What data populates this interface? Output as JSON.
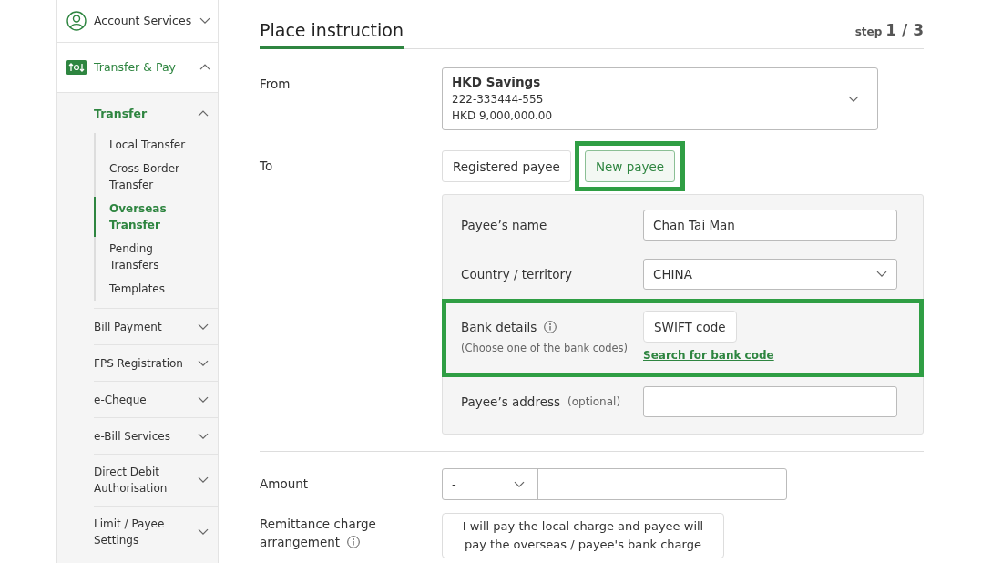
{
  "sidebar": {
    "sections": [
      {
        "label": "Account Services",
        "kind": "account",
        "expanded": false
      },
      {
        "label": "Transfer & Pay",
        "kind": "transfer",
        "expanded": true,
        "groups": [
          {
            "label": "Transfer",
            "expanded": true,
            "children": [
              {
                "label": "Local Transfer",
                "selected": false
              },
              {
                "label": "Cross-Border Transfer",
                "selected": false
              },
              {
                "label": "Overseas Transfer",
                "selected": true
              },
              {
                "label": "Pending Transfers",
                "selected": false
              },
              {
                "label": "Templates",
                "selected": false
              }
            ]
          },
          {
            "label": "Bill Payment",
            "expanded": false
          },
          {
            "label": "FPS Registration",
            "expanded": false
          },
          {
            "label": "e-Cheque",
            "expanded": false
          },
          {
            "label": "e-Bill Services",
            "expanded": false
          },
          {
            "label": "Direct Debit Authorisation",
            "expanded": false
          },
          {
            "label": "Limit / Payee Settings",
            "expanded": false
          }
        ]
      }
    ]
  },
  "header": {
    "title": "Place instruction",
    "step_label": "step",
    "step_value": "1 / 3"
  },
  "from": {
    "label": "From",
    "account": {
      "name": "HKD Savings",
      "number": "222-333444-555",
      "balance": "HKD 9,000,000.00"
    }
  },
  "to": {
    "label": "To",
    "options": [
      {
        "label": "Registered payee",
        "selected": false,
        "highlighted": false
      },
      {
        "label": "New payee",
        "selected": true,
        "highlighted": true
      }
    ]
  },
  "payee": {
    "rows": [
      {
        "kind": "text",
        "label": "Payee’s name",
        "value": "Chan Tai Man",
        "highlighted": false
      },
      {
        "kind": "select",
        "label": "Country / territory",
        "value": "CHINA",
        "highlighted": false
      },
      {
        "kind": "bank",
        "label": "Bank details",
        "hint": "(Choose one of the bank codes)",
        "button": "SWIFT code",
        "link": "Search for bank code",
        "highlighted": true
      },
      {
        "kind": "text",
        "label": "Payee’s address",
        "optional": "(optional)",
        "highlighted": false
      }
    ]
  },
  "amount": {
    "label": "Amount",
    "currency": "-"
  },
  "charge": {
    "label_lines": [
      "Remittance charge",
      "arrangement"
    ],
    "option": "I will pay the local charge and payee will pay the overseas / payee's bank charge"
  }
}
